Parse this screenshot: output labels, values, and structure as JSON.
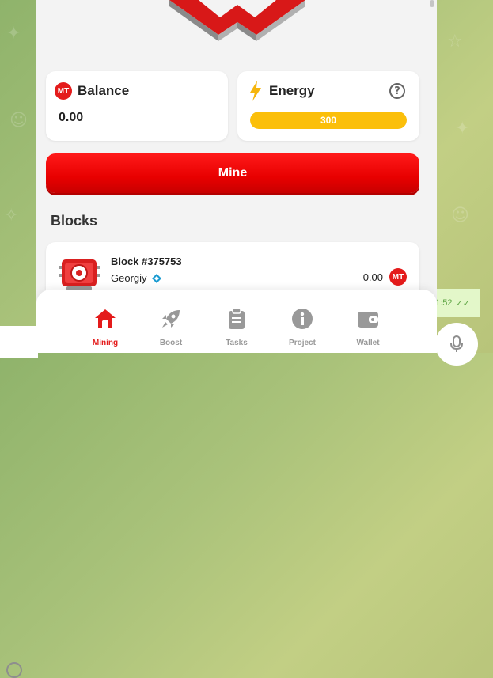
{
  "balance": {
    "title": "Balance",
    "value": "0.00",
    "badge": "MT"
  },
  "energy": {
    "title": "Energy",
    "value": "300",
    "level": 1.0,
    "help_icon": "question-circle-icon",
    "icon": "lightning-bolt-icon"
  },
  "mine_button": {
    "label": "Mine"
  },
  "blocks": {
    "title": "Blocks",
    "items": [
      {
        "number": "Block #375753",
        "user": "Georgiy",
        "reward": "0.00",
        "badge": "MT"
      }
    ]
  },
  "nav": {
    "items": [
      {
        "label": "Mining",
        "icon": "home-icon",
        "active": true
      },
      {
        "label": "Boost",
        "icon": "rocket-icon",
        "active": false
      },
      {
        "label": "Tasks",
        "icon": "clipboard-icon",
        "active": false
      },
      {
        "label": "Project",
        "icon": "info-icon",
        "active": false
      },
      {
        "label": "Wallet",
        "icon": "wallet-icon",
        "active": false
      }
    ]
  },
  "chat": {
    "message_time": "1:52"
  },
  "colors": {
    "accent": "#e41b1b",
    "energy": "#fbbf0a",
    "panel": "#f3f3f3"
  }
}
